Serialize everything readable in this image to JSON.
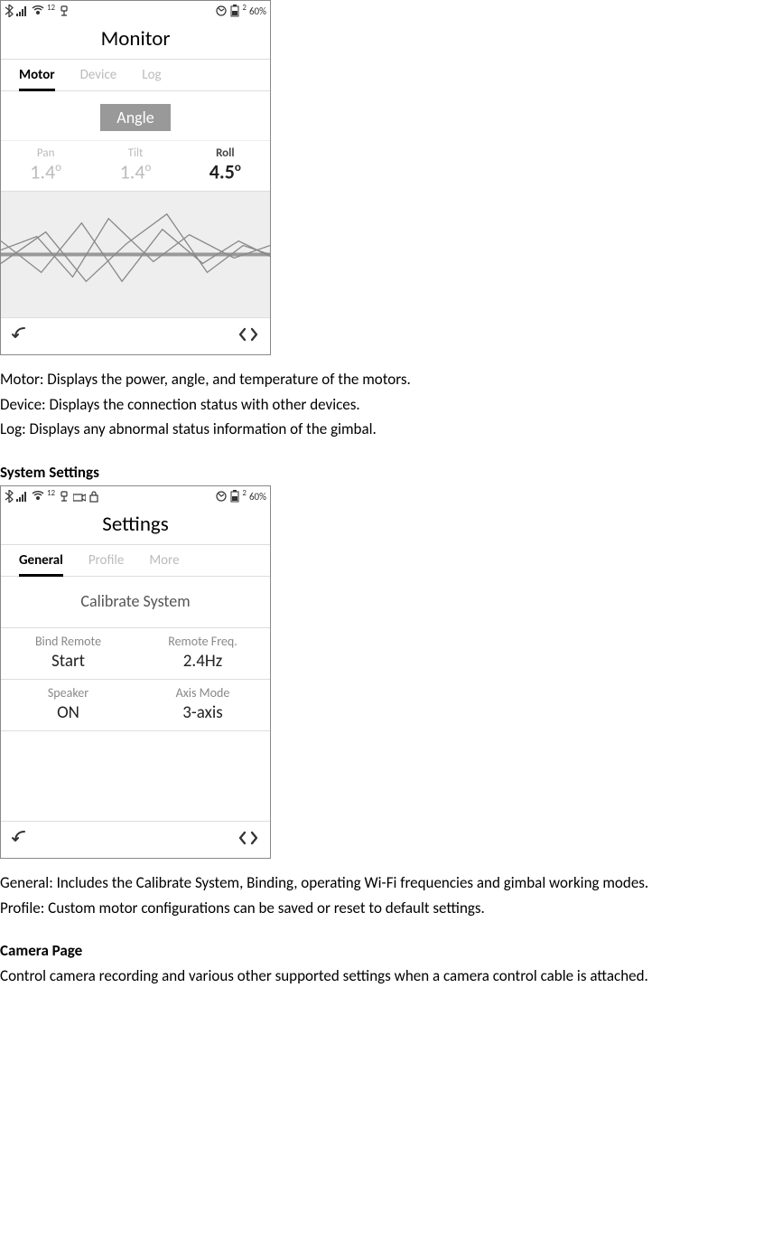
{
  "monitor_phone": {
    "status_bar": {
      "badge_number": "12",
      "sim_number": "2",
      "battery_percent": "60%"
    },
    "title": "Monitor",
    "tabs": {
      "motor": "Motor",
      "device": "Device",
      "log": "Log"
    },
    "chip_label": "Angle",
    "axes": {
      "pan": {
        "label": "Pan",
        "value": "1.4"
      },
      "tilt": {
        "label": "Tilt",
        "value": "1.4"
      },
      "roll": {
        "label": "Roll",
        "value": "4.5"
      }
    }
  },
  "monitor_text": {
    "motor": "Motor: Displays the power, angle, and temperature of the motors.",
    "device": "Device: Displays the connection status with other devices.",
    "log": "Log: Displays any abnormal status information of the gimbal."
  },
  "system_settings_heading": "System Settings",
  "settings_phone": {
    "status_bar": {
      "badge_number": "12",
      "sim_number": "2",
      "battery_percent": "60%"
    },
    "title": "Settings",
    "tabs": {
      "general": "General",
      "profile": "Profile",
      "more": "More"
    },
    "calibrate": "Calibrate System",
    "rows": {
      "bind_remote": {
        "label": "Bind Remote",
        "value": "Start"
      },
      "remote_freq": {
        "label": "Remote Freq.",
        "value": "2.4Hz"
      },
      "speaker": {
        "label": "Speaker",
        "value": "ON"
      },
      "axis_mode": {
        "label": "Axis Mode",
        "value": "3-axis"
      }
    }
  },
  "settings_text": {
    "general": "General: Includes the Calibrate System, Binding, operating Wi-Fi frequencies and gimbal working modes.",
    "profile": "Profile: Custom motor configurations can be saved or reset to default settings."
  },
  "camera_heading": "Camera Page",
  "camera_text": "Control camera recording and various other supported settings when a camera control cable is attached.",
  "chart_data": {
    "type": "line",
    "description": "Real-time angle monitor plot for Pan/Tilt/Roll axes",
    "series": [
      {
        "name": "Pan",
        "values": [
          0,
          5,
          -8,
          12,
          -4,
          6,
          -2,
          3
        ]
      },
      {
        "name": "Tilt",
        "values": [
          2,
          -6,
          10,
          -12,
          8,
          -3,
          5,
          -1
        ]
      },
      {
        "name": "Roll",
        "values": [
          -3,
          7,
          -10,
          4,
          11,
          -6,
          2,
          0
        ]
      }
    ],
    "ylim": [
      -20,
      20
    ]
  }
}
